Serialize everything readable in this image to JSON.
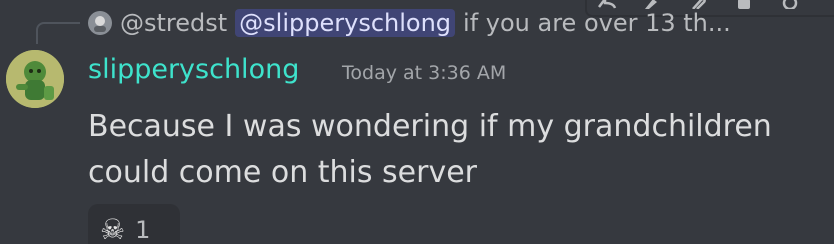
{
  "reply": {
    "author": "@stredst",
    "mention": "@slipperyschlong",
    "snippet": "if you are over 13 th..."
  },
  "message": {
    "username": "slipperyschlong",
    "timestamp": "Today at 3:36 AM",
    "text": "Because I was wondering if my grandchildren could come on this server"
  },
  "reaction": {
    "emoji": "☠",
    "count": "1"
  },
  "colors": {
    "background": "#36393f",
    "username": "#3ee3cc",
    "mention_bg": "#3c4270",
    "text": "#dcddde"
  }
}
